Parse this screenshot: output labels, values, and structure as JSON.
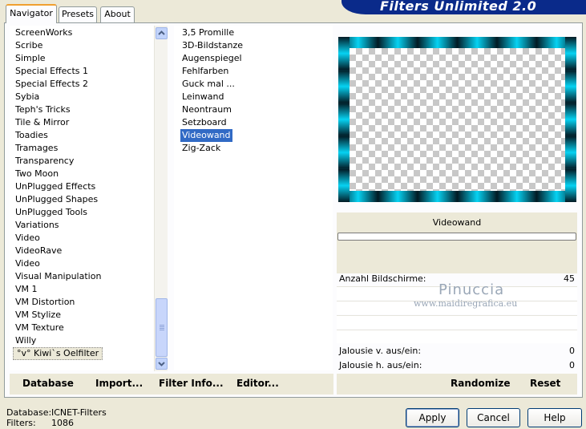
{
  "app": {
    "title": "Filters Unlimited 2.0"
  },
  "tabs": [
    {
      "label": "Navigator",
      "active": true
    },
    {
      "label": "Presets",
      "active": false
    },
    {
      "label": "About",
      "active": false
    }
  ],
  "categories": [
    "ScreenWorks",
    "Scribe",
    "Simple",
    "Special Effects 1",
    "Special Effects 2",
    "Sybia",
    "Teph's Tricks",
    "Tile & Mirror",
    "Toadies",
    "Tramages",
    "Transparency",
    "Two Moon",
    "UnPlugged Effects",
    "UnPlugged Shapes",
    "UnPlugged Tools",
    "Variations",
    "Video",
    "VideoRave",
    "Video",
    "Visual Manipulation",
    "VM 1",
    "VM Distortion",
    "VM Stylize",
    "VM Texture",
    "Willy",
    "°v° Kiwi`s Oelfilter"
  ],
  "selected_category": "°v° Kiwi`s Oelfilter",
  "filters": [
    "3,5 Promille",
    "3D-Bildstanze",
    "Augenspiegel",
    "Fehlfarben",
    "Guck mal ...",
    "Leinwand",
    "Neontraum",
    "Setzboard",
    "Videowand",
    "Zig-Zack"
  ],
  "selected_filter": "Videowand",
  "preview": {
    "filter_name": "Videowand",
    "frame_color": "#03aed0",
    "progress": 0
  },
  "params": [
    {
      "label": "Anzahl Bildschirme:",
      "value": "45"
    },
    {
      "label": "Jalousie v. aus/ein:",
      "value": "0"
    },
    {
      "label": "Jalousie h. aus/ein:",
      "value": "0"
    }
  ],
  "watermark": {
    "name": "Pinuccia",
    "url": "www.maidiregrafica.eu"
  },
  "toolbar": {
    "database": "Database",
    "import": "Import...",
    "filter_info": "Filter Info...",
    "editor": "Editor...",
    "randomize": "Randomize",
    "reset": "Reset"
  },
  "status": {
    "database_label": "Database:",
    "database_value": "ICNET-Filters",
    "filters_label": "Filters:",
    "filters_value": "1086"
  },
  "buttons": {
    "apply": "Apply",
    "cancel": "Cancel",
    "help": "Help"
  },
  "colors": {
    "selection": "#316ac5",
    "banner": "#0a2a8a",
    "dialog": "#ece9d8"
  }
}
